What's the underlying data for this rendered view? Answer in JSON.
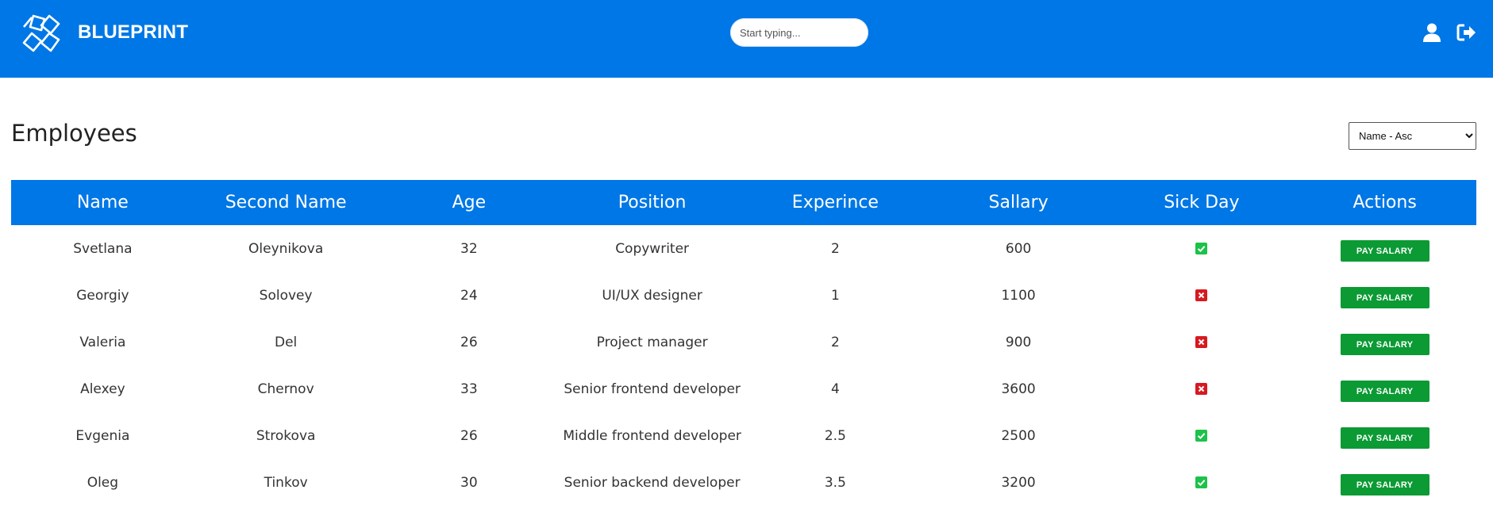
{
  "header": {
    "brand": "BLUEPRINT",
    "search_placeholder": "Start typing...",
    "icons": [
      "logo-icon",
      "user-icon",
      "logout-icon"
    ],
    "color": "#0077e6"
  },
  "page": {
    "title": "Employees",
    "sort_value": "Name - Asc"
  },
  "table": {
    "columns": [
      "Name",
      "Second Name",
      "Age",
      "Position",
      "Experince",
      "Sallary",
      "Sick Day",
      "Actions"
    ],
    "rows": [
      {
        "name": "Svetlana",
        "second_name": "Oleynikova",
        "age": "32",
        "position": "Copywriter",
        "experience": "2",
        "salary": "600",
        "sick_day": true,
        "action": "PAY SALARY"
      },
      {
        "name": "Georgiy",
        "second_name": "Solovey",
        "age": "24",
        "position": "UI/UX designer",
        "experience": "1",
        "salary": "1100",
        "sick_day": false,
        "action": "PAY SALARY"
      },
      {
        "name": "Valeria",
        "second_name": "Del",
        "age": "26",
        "position": "Project manager",
        "experience": "2",
        "salary": "900",
        "sick_day": false,
        "action": "PAY SALARY"
      },
      {
        "name": "Alexey",
        "second_name": "Chernov",
        "age": "33",
        "position": "Senior frontend developer",
        "experience": "4",
        "salary": "3600",
        "sick_day": false,
        "action": "PAY SALARY"
      },
      {
        "name": "Evgenia",
        "second_name": "Strokova",
        "age": "26",
        "position": "Middle frontend developer",
        "experience": "2.5",
        "salary": "2500",
        "sick_day": true,
        "action": "PAY SALARY"
      },
      {
        "name": "Oleg",
        "second_name": "Tinkov",
        "age": "30",
        "position": "Senior backend developer",
        "experience": "3.5",
        "salary": "3200",
        "sick_day": true,
        "action": "PAY SALARY"
      }
    ]
  },
  "colors": {
    "sick_true": "#1dc24a",
    "sick_false": "#d71920",
    "button": "#0b9a34"
  }
}
